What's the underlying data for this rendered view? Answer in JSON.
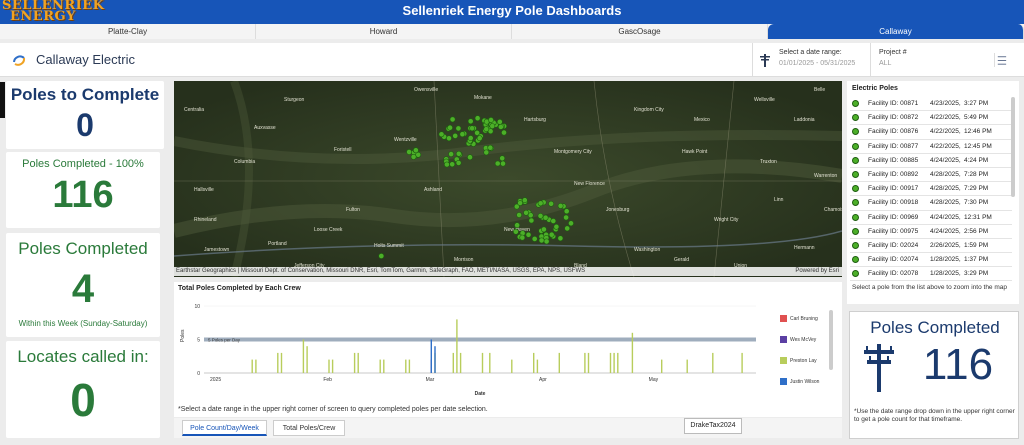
{
  "header": {
    "logo_line1": "SELLENRIEK",
    "logo_line2": "ENERGY",
    "title": "Sellenriek Energy Pole Dashboards"
  },
  "tabs": [
    {
      "label": "Platte-Clay",
      "active": false
    },
    {
      "label": "Howard",
      "active": false
    },
    {
      "label": "GascOsage",
      "active": false
    },
    {
      "label": "Callaway",
      "active": true
    }
  ],
  "subheader": {
    "brand": "Callaway Electric",
    "date_label": "Select a date range:",
    "date_value": "01/01/2025 - 05/31/2025",
    "project_label": "Project #",
    "project_value": "ALL"
  },
  "cards": {
    "to_complete_title": "Poles to Complete",
    "to_complete_value": "0",
    "completed_pct_title": "Poles Completed - 100%",
    "completed_pct_value": "116",
    "week_title": "Poles Completed",
    "week_value": "4",
    "week_sub": "Within this Week (Sunday-Saturday)",
    "locates_title": "Locates called in:",
    "locates_value": "0"
  },
  "map": {
    "attribution": "Earthstar Geographics | Missouri Dept. of Conservation, Missouri DNR, Esri, TomTom, Garmin, SafeGraph, FAO, METI/NASA, USGS, EPA, NPS, USFWS",
    "powered_by": "Powered by Esri",
    "places": [
      "Auxvasse",
      "Columbia",
      "Fulton",
      "Jamestown",
      "Portland",
      "Montgomery City",
      "Hawk Point",
      "Truxton",
      "Warrenton",
      "New Florence",
      "Jonesburg",
      "Wright City",
      "Hermann",
      "Holts Summit",
      "Jefferson City",
      "Ashland",
      "Hartsburg",
      "Mokane",
      "Kingdom City",
      "Mexico",
      "Wellsville",
      "Laddonia",
      "Hallsville",
      "Centralia",
      "Sturgeon",
      "Foristell",
      "Wentzville",
      "New Haven",
      "Washington",
      "Gerald",
      "Union",
      "Linn",
      "Chamois",
      "Rhineland",
      "Loose Creek",
      "Morrison",
      "Bland",
      "Owensville",
      "Belle"
    ]
  },
  "chart_data": {
    "type": "bar",
    "title": "Total Poles Completed by Each Crew",
    "xlabel": "Date",
    "ylabel": "Poles",
    "ylim": [
      0,
      10
    ],
    "yticks": [
      0,
      5,
      10
    ],
    "xticks": [
      "2025",
      "Feb",
      "Mar",
      "Apr",
      "May"
    ],
    "reference_line": {
      "label": "5 Poles per Day",
      "value": 5
    },
    "series": [
      {
        "name": "Carl Bruning",
        "color": "#e05151",
        "points": []
      },
      {
        "name": "Wes McVey",
        "color": "#5b3fa3",
        "points": [
          {
            "date": "2025-03-04",
            "value": 2
          }
        ]
      },
      {
        "name": "Preston Lay",
        "color": "#b8cd5c",
        "points": [
          {
            "date": "2025-01-14",
            "value": 2
          },
          {
            "date": "2025-01-15",
            "value": 2
          },
          {
            "date": "2025-01-21",
            "value": 3
          },
          {
            "date": "2025-01-22",
            "value": 3
          },
          {
            "date": "2025-01-28",
            "value": 5
          },
          {
            "date": "2025-01-29",
            "value": 4
          },
          {
            "date": "2025-02-04",
            "value": 2
          },
          {
            "date": "2025-02-05",
            "value": 2
          },
          {
            "date": "2025-02-11",
            "value": 3
          },
          {
            "date": "2025-02-12",
            "value": 3
          },
          {
            "date": "2025-02-18",
            "value": 2
          },
          {
            "date": "2025-02-19",
            "value": 2
          },
          {
            "date": "2025-02-25",
            "value": 2
          },
          {
            "date": "2025-02-26",
            "value": 2
          },
          {
            "date": "2025-03-05",
            "value": 3
          },
          {
            "date": "2025-03-10",
            "value": 3
          },
          {
            "date": "2025-03-11",
            "value": 8
          },
          {
            "date": "2025-03-12",
            "value": 3
          },
          {
            "date": "2025-03-18",
            "value": 3
          },
          {
            "date": "2025-03-20",
            "value": 3
          },
          {
            "date": "2025-03-26",
            "value": 2
          },
          {
            "date": "2025-04-01",
            "value": 3
          },
          {
            "date": "2025-04-02",
            "value": 2
          },
          {
            "date": "2025-04-08",
            "value": 3
          },
          {
            "date": "2025-04-15",
            "value": 3
          },
          {
            "date": "2025-04-16",
            "value": 3
          },
          {
            "date": "2025-04-22",
            "value": 3
          },
          {
            "date": "2025-04-23",
            "value": 3
          },
          {
            "date": "2025-04-24",
            "value": 3
          },
          {
            "date": "2025-04-28",
            "value": 6
          },
          {
            "date": "2025-05-06",
            "value": 2
          },
          {
            "date": "2025-05-13",
            "value": 2
          },
          {
            "date": "2025-05-20",
            "value": 3
          },
          {
            "date": "2025-05-28",
            "value": 3
          }
        ]
      },
      {
        "name": "Justin Wilson",
        "color": "#2f6fc8",
        "points": [
          {
            "date": "2025-03-04",
            "value": 5
          },
          {
            "date": "2025-03-05",
            "value": 4
          }
        ]
      }
    ]
  },
  "chart_note": "*Select a date range in the upper right corner of screen to query completed poles per date selection.",
  "bottom_tabs": [
    {
      "label": "Pole Count/Day/Week",
      "active": true
    },
    {
      "label": "Total Poles/Crew",
      "active": false
    }
  ],
  "taskbar_label": "DrakeTax2024",
  "electric_poles": {
    "title": "Electric Poles",
    "items": [
      {
        "facility": "Facility ID: 00871",
        "date": "4/23/2025,",
        "time": "3:27 PM"
      },
      {
        "facility": "Facility ID: 00872",
        "date": "4/22/2025,",
        "time": "5:49 PM"
      },
      {
        "facility": "Facility ID: 00876",
        "date": "4/22/2025,",
        "time": "12:46 PM"
      },
      {
        "facility": "Facility ID: 00877",
        "date": "4/22/2025,",
        "time": "12:45 PM"
      },
      {
        "facility": "Facility ID: 00885",
        "date": "4/24/2025,",
        "time": "4:24 PM"
      },
      {
        "facility": "Facility ID: 00892",
        "date": "4/28/2025,",
        "time": "7:28 PM"
      },
      {
        "facility": "Facility ID: 00917",
        "date": "4/28/2025,",
        "time": "7:29 PM"
      },
      {
        "facility": "Facility ID: 00918",
        "date": "4/28/2025,",
        "time": "7:30 PM"
      },
      {
        "facility": "Facility ID: 00969",
        "date": "4/24/2025,",
        "time": "12:31 PM"
      },
      {
        "facility": "Facility ID: 00975",
        "date": "4/24/2025,",
        "time": "2:56 PM"
      },
      {
        "facility": "Facility ID: 02024",
        "date": "2/26/2025,",
        "time": "1:59 PM"
      },
      {
        "facility": "Facility ID: 02074",
        "date": "1/28/2025,",
        "time": "1:37 PM"
      },
      {
        "facility": "Facility ID: 02078",
        "date": "1/28/2025,",
        "time": "3:29 PM"
      }
    ],
    "footer": "Select a pole from the list above to zoom into the map"
  },
  "big_card": {
    "title": "Poles Completed",
    "value": "116",
    "note": "*Use the date range drop down in the upper right corner to get a pole count for that timeframe."
  },
  "colors": {
    "header": "#1755b8",
    "navy": "#1b3a6d",
    "green": "#2a7a3a",
    "pole_dot": "#4caf28"
  }
}
